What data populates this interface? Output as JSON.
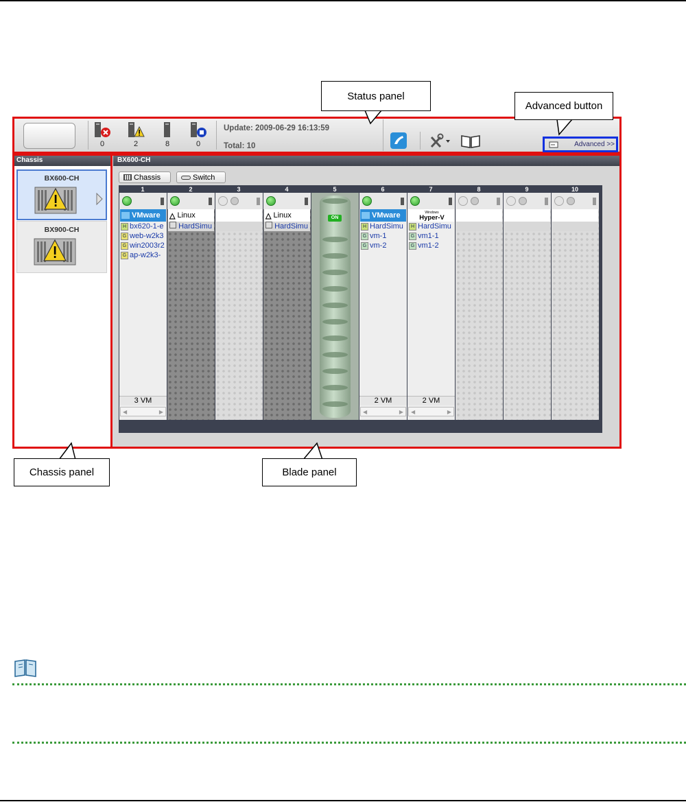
{
  "callouts": {
    "status_panel": "Status panel",
    "advanced_button": "Advanced button",
    "chassis_panel": "Chassis panel",
    "blade_panel": "Blade panel"
  },
  "status": {
    "counts": [
      "0",
      "2",
      "8",
      "0"
    ],
    "icons": [
      "server-error-icon",
      "server-warning-icon",
      "server-icon",
      "server-maintenance-icon"
    ],
    "update": "Update: 2009-06-29 16:13:59",
    "total": "Total: 10",
    "advanced_label": "Advanced >>"
  },
  "chassis_panel": {
    "title": "Chassis",
    "items": [
      {
        "name": "BX600-CH",
        "selected": true
      },
      {
        "name": "BX900-CH",
        "selected": false
      }
    ]
  },
  "blade_panel": {
    "title": "BX600-CH",
    "tabs": [
      "Chassis",
      "Switch"
    ],
    "slot_numbers": [
      "1",
      "2",
      "3",
      "4",
      "5",
      "6",
      "7",
      "8",
      "9",
      "10"
    ],
    "slots": [
      {
        "type": "vmhost",
        "power": "on",
        "os": "VMware",
        "hw": "bx620-1-e",
        "vms": [
          "web-w2k3",
          "win2003r2",
          "ap-w2k3-"
        ],
        "count": "3 VM"
      },
      {
        "type": "physical",
        "power": "on",
        "os": "Linux",
        "hw": "HardSimu"
      },
      {
        "type": "empty-light",
        "power": "off"
      },
      {
        "type": "physical",
        "power": "on",
        "os": "Linux",
        "hw": "HardSimu"
      },
      {
        "type": "switch",
        "badge": "ON"
      },
      {
        "type": "vmhost",
        "power": "on",
        "os": "VMware",
        "hw": "HardSimu",
        "vms": [
          "vm-1",
          "vm-2"
        ],
        "count": "2 VM"
      },
      {
        "type": "vmhost",
        "power": "on",
        "os_small": "Windows",
        "os": "Hyper-V",
        "hw": "HardSimu",
        "vms": [
          "vm1-1",
          "vm1-2"
        ],
        "count": "2 VM"
      },
      {
        "type": "empty",
        "power": "off"
      },
      {
        "type": "empty",
        "power": "off"
      },
      {
        "type": "empty",
        "power": "off"
      }
    ]
  },
  "colors": {
    "highlight": "#e01010",
    "advanced_highlight": "#1030e0",
    "note_dots": "#3a9a3a"
  }
}
